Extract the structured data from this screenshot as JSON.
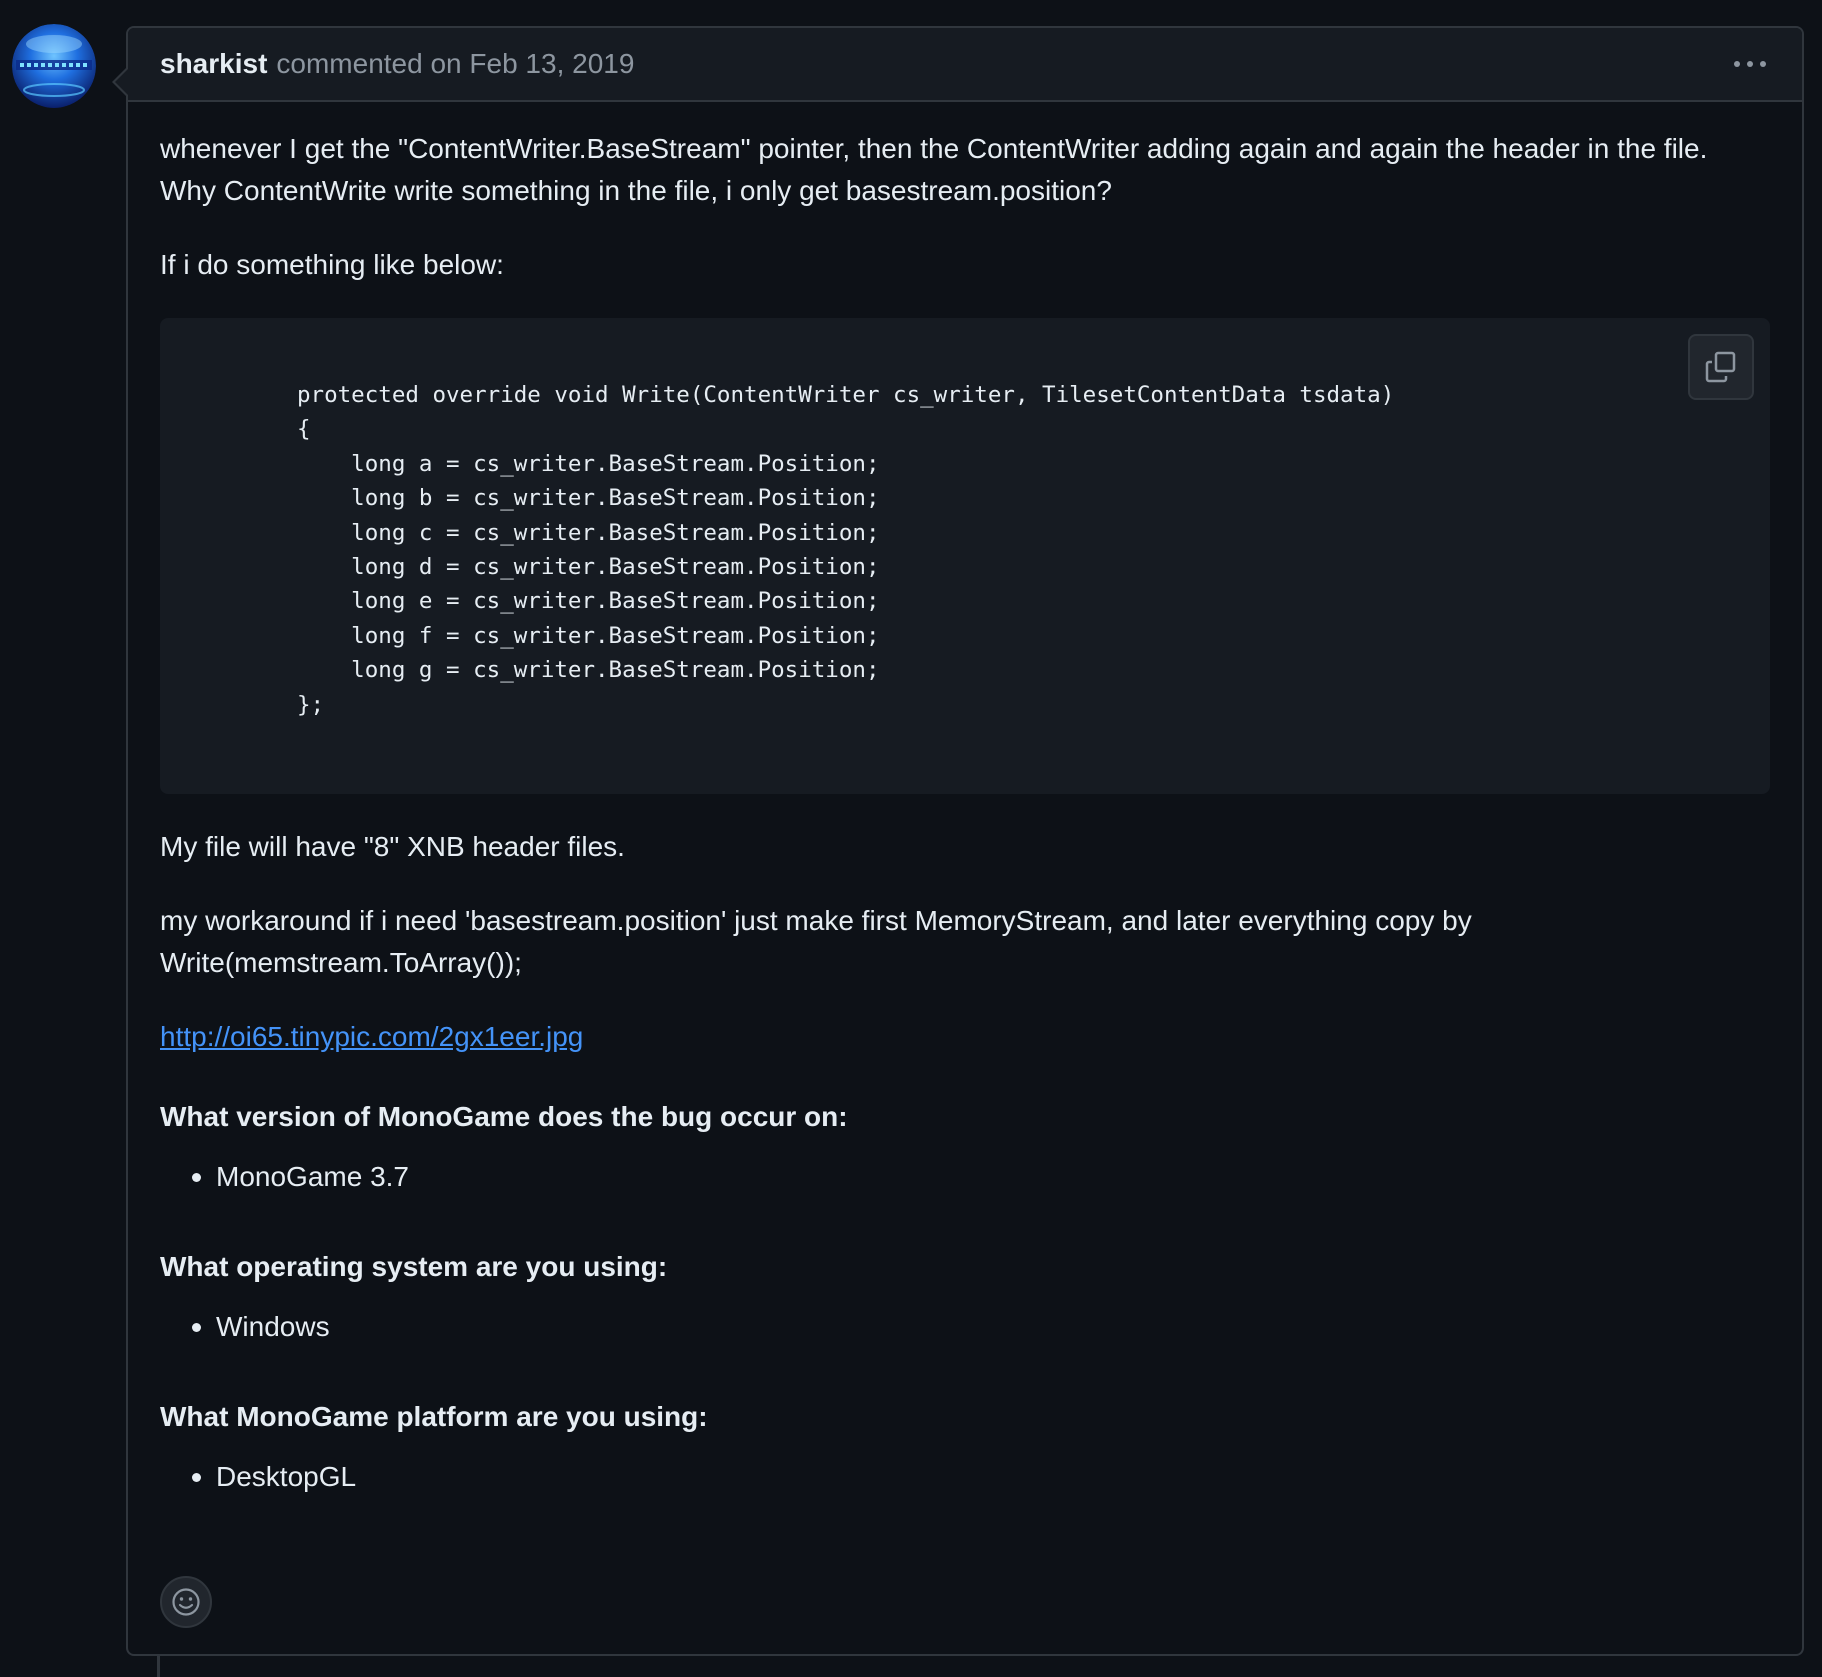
{
  "comment": {
    "author": "sharkist",
    "action_text": "commented on Feb 13, 2019",
    "paragraph_1_line_1": "whenever I get the \"ContentWriter.BaseStream\" pointer, then the ContentWriter adding again and again the header in the file.",
    "paragraph_1_line_2": "Why ContentWrite write something in the file, i only get basestream.position?",
    "paragraph_2": "If i do something like below:",
    "code_lines": [
      "protected override void Write(ContentWriter cs_writer, TilesetContentData tsdata)",
      "{",
      "    long a = cs_writer.BaseStream.Position;",
      "    long b = cs_writer.BaseStream.Position;",
      "    long c = cs_writer.BaseStream.Position;",
      "    long d = cs_writer.BaseStream.Position;",
      "    long e = cs_writer.BaseStream.Position;",
      "    long f = cs_writer.BaseStream.Position;",
      "    long g = cs_writer.BaseStream.Position;",
      "};"
    ],
    "paragraph_3": "My file will have \"8\" XNB header files.",
    "paragraph_4_line_1": "my workaround if i need 'basestream.position' just make first MemoryStream, and later everything copy by",
    "paragraph_4_line_2": "Write(memstream.ToArray());",
    "link_text": "http://oi65.tinypic.com/2gx1eer.jpg",
    "sections": [
      {
        "heading": "What version of MonoGame does the bug occur on:",
        "items": [
          "MonoGame 3.7"
        ]
      },
      {
        "heading": "What operating system are you using:",
        "items": [
          "Windows"
        ]
      },
      {
        "heading": "What MonoGame platform are you using:",
        "items": [
          "DesktopGL"
        ]
      }
    ]
  },
  "icons": {
    "kebab": "kebab-horizontal-icon",
    "copy": "copy-icon",
    "reaction": "smiley-icon"
  },
  "colors": {
    "background": "#0d1117",
    "header_background": "#161b22",
    "border": "#30363d",
    "text": "#e6edf3",
    "muted": "#8d96a0",
    "link": "#4493f8"
  }
}
